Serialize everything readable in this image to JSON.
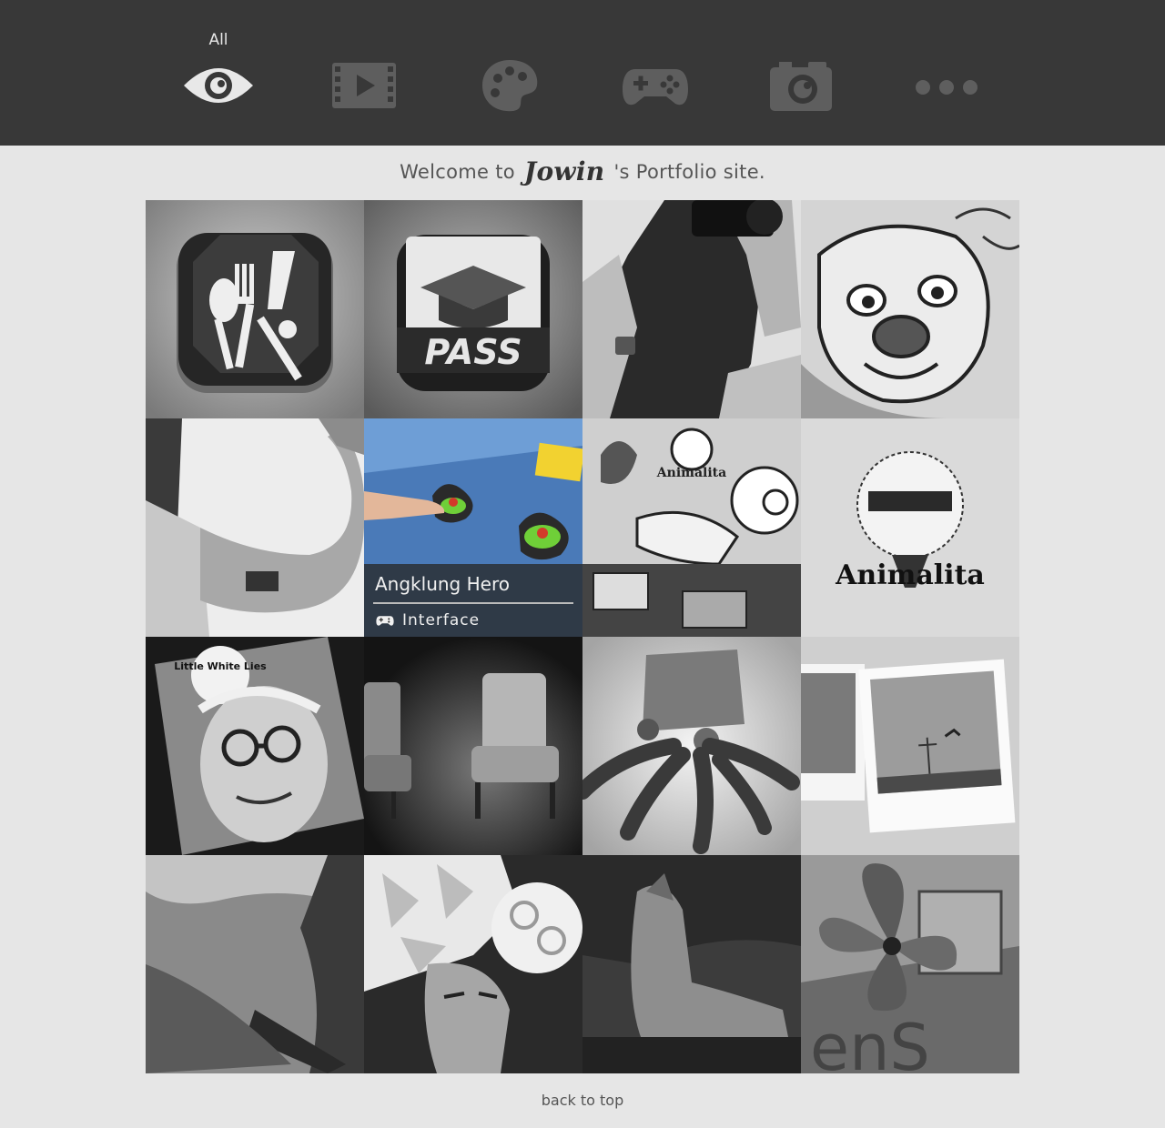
{
  "nav": {
    "categories": [
      {
        "label": "All",
        "icon": "eye-icon",
        "active": true
      },
      {
        "label": "",
        "icon": "film-icon",
        "active": false
      },
      {
        "label": "",
        "icon": "palette-icon",
        "active": false
      },
      {
        "label": "",
        "icon": "gamepad-icon",
        "active": false
      },
      {
        "label": "",
        "icon": "camera-icon",
        "active": false
      },
      {
        "label": "",
        "icon": "more-icon",
        "active": false
      }
    ]
  },
  "welcome": {
    "prefix": "Welcome to",
    "name": "Jowin",
    "suffix": "'s Portfolio site."
  },
  "grid": {
    "tiles": [
      {
        "subject": "restaurant app icon",
        "icon_text": ""
      },
      {
        "subject": "graduation app icon",
        "icon_text": "PASS"
      },
      {
        "subject": "photographer portrait"
      },
      {
        "subject": "pug illustration"
      },
      {
        "subject": "arm with tattoo"
      },
      {
        "subject": "angklung hero game",
        "hover_title": "Angklung Hero",
        "hover_category": "Interface",
        "hover_icon": "gamepad-icon"
      },
      {
        "subject": "animalita mural",
        "mural_text": "Animalita"
      },
      {
        "subject": "animalita logo",
        "logo_text": "Animalita"
      },
      {
        "subject": "magazine collage",
        "magazine_text": "Little White Lies"
      },
      {
        "subject": "armchairs"
      },
      {
        "subject": "octopus sculpture"
      },
      {
        "subject": "polaroid photos"
      },
      {
        "subject": "boat river"
      },
      {
        "subject": "paper headdress"
      },
      {
        "subject": "dog"
      },
      {
        "subject": "flower sign"
      }
    ]
  },
  "footer": {
    "back_to_top": "back to top"
  }
}
